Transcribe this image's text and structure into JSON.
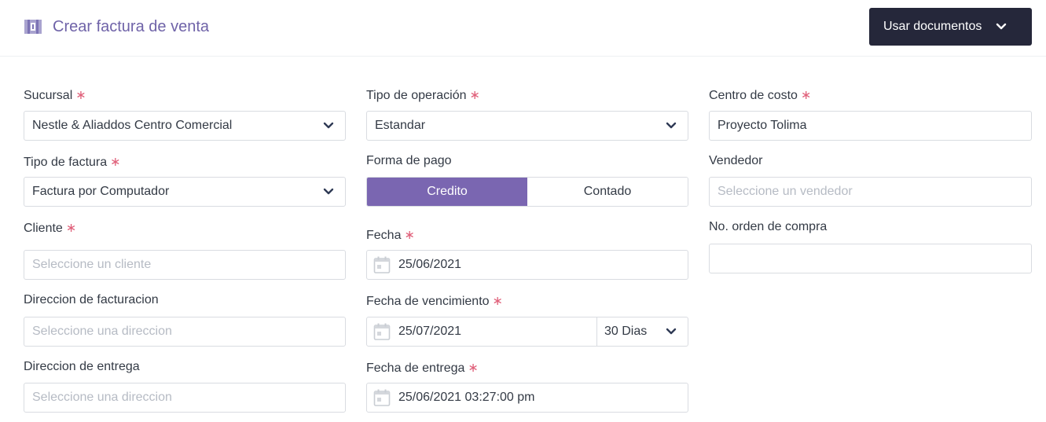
{
  "header": {
    "title": "Crear factura de venta",
    "use_documents_label": "Usar documentos"
  },
  "form": {
    "sucursal": {
      "label": "Sucursal",
      "value": "Nestle & Aliaddos Centro Comercial"
    },
    "tipo_operacion": {
      "label": "Tipo de operación",
      "value": "Estandar"
    },
    "centro_costo": {
      "label": "Centro de costo",
      "value": "Proyecto Tolima"
    },
    "tipo_factura": {
      "label": "Tipo de factura",
      "value": "Factura por Computador"
    },
    "forma_pago": {
      "label": "Forma de pago",
      "options": [
        "Credito",
        "Contado"
      ],
      "selected": "Credito"
    },
    "vendedor": {
      "label": "Vendedor",
      "placeholder": "Seleccione un vendedor"
    },
    "cliente": {
      "label": "Cliente",
      "placeholder": "Seleccione un cliente"
    },
    "fecha": {
      "label": "Fecha",
      "value": "25/06/2021"
    },
    "orden_compra": {
      "label": "No. orden de compra",
      "value": ""
    },
    "direccion_facturacion": {
      "label": "Direccion de facturacion",
      "placeholder": "Seleccione una direccion"
    },
    "fecha_vencimiento": {
      "label": "Fecha de vencimiento",
      "value": "25/07/2021",
      "term": "30 Dias"
    },
    "direccion_entrega": {
      "label": "Direccion de entrega",
      "placeholder": "Seleccione una direccion"
    },
    "fecha_entrega": {
      "label": "Fecha de entrega",
      "value": "25/06/2021 03:27:00 pm"
    },
    "required_mark": "∗"
  },
  "colors": {
    "accent": "#7a66b1",
    "title": "#6f63a8",
    "dark_button": "#25273a",
    "required": "#e0607a"
  },
  "icons": {
    "title": "invoice-icon",
    "dropdown": "chevron-down-icon",
    "date": "calendar-icon"
  }
}
